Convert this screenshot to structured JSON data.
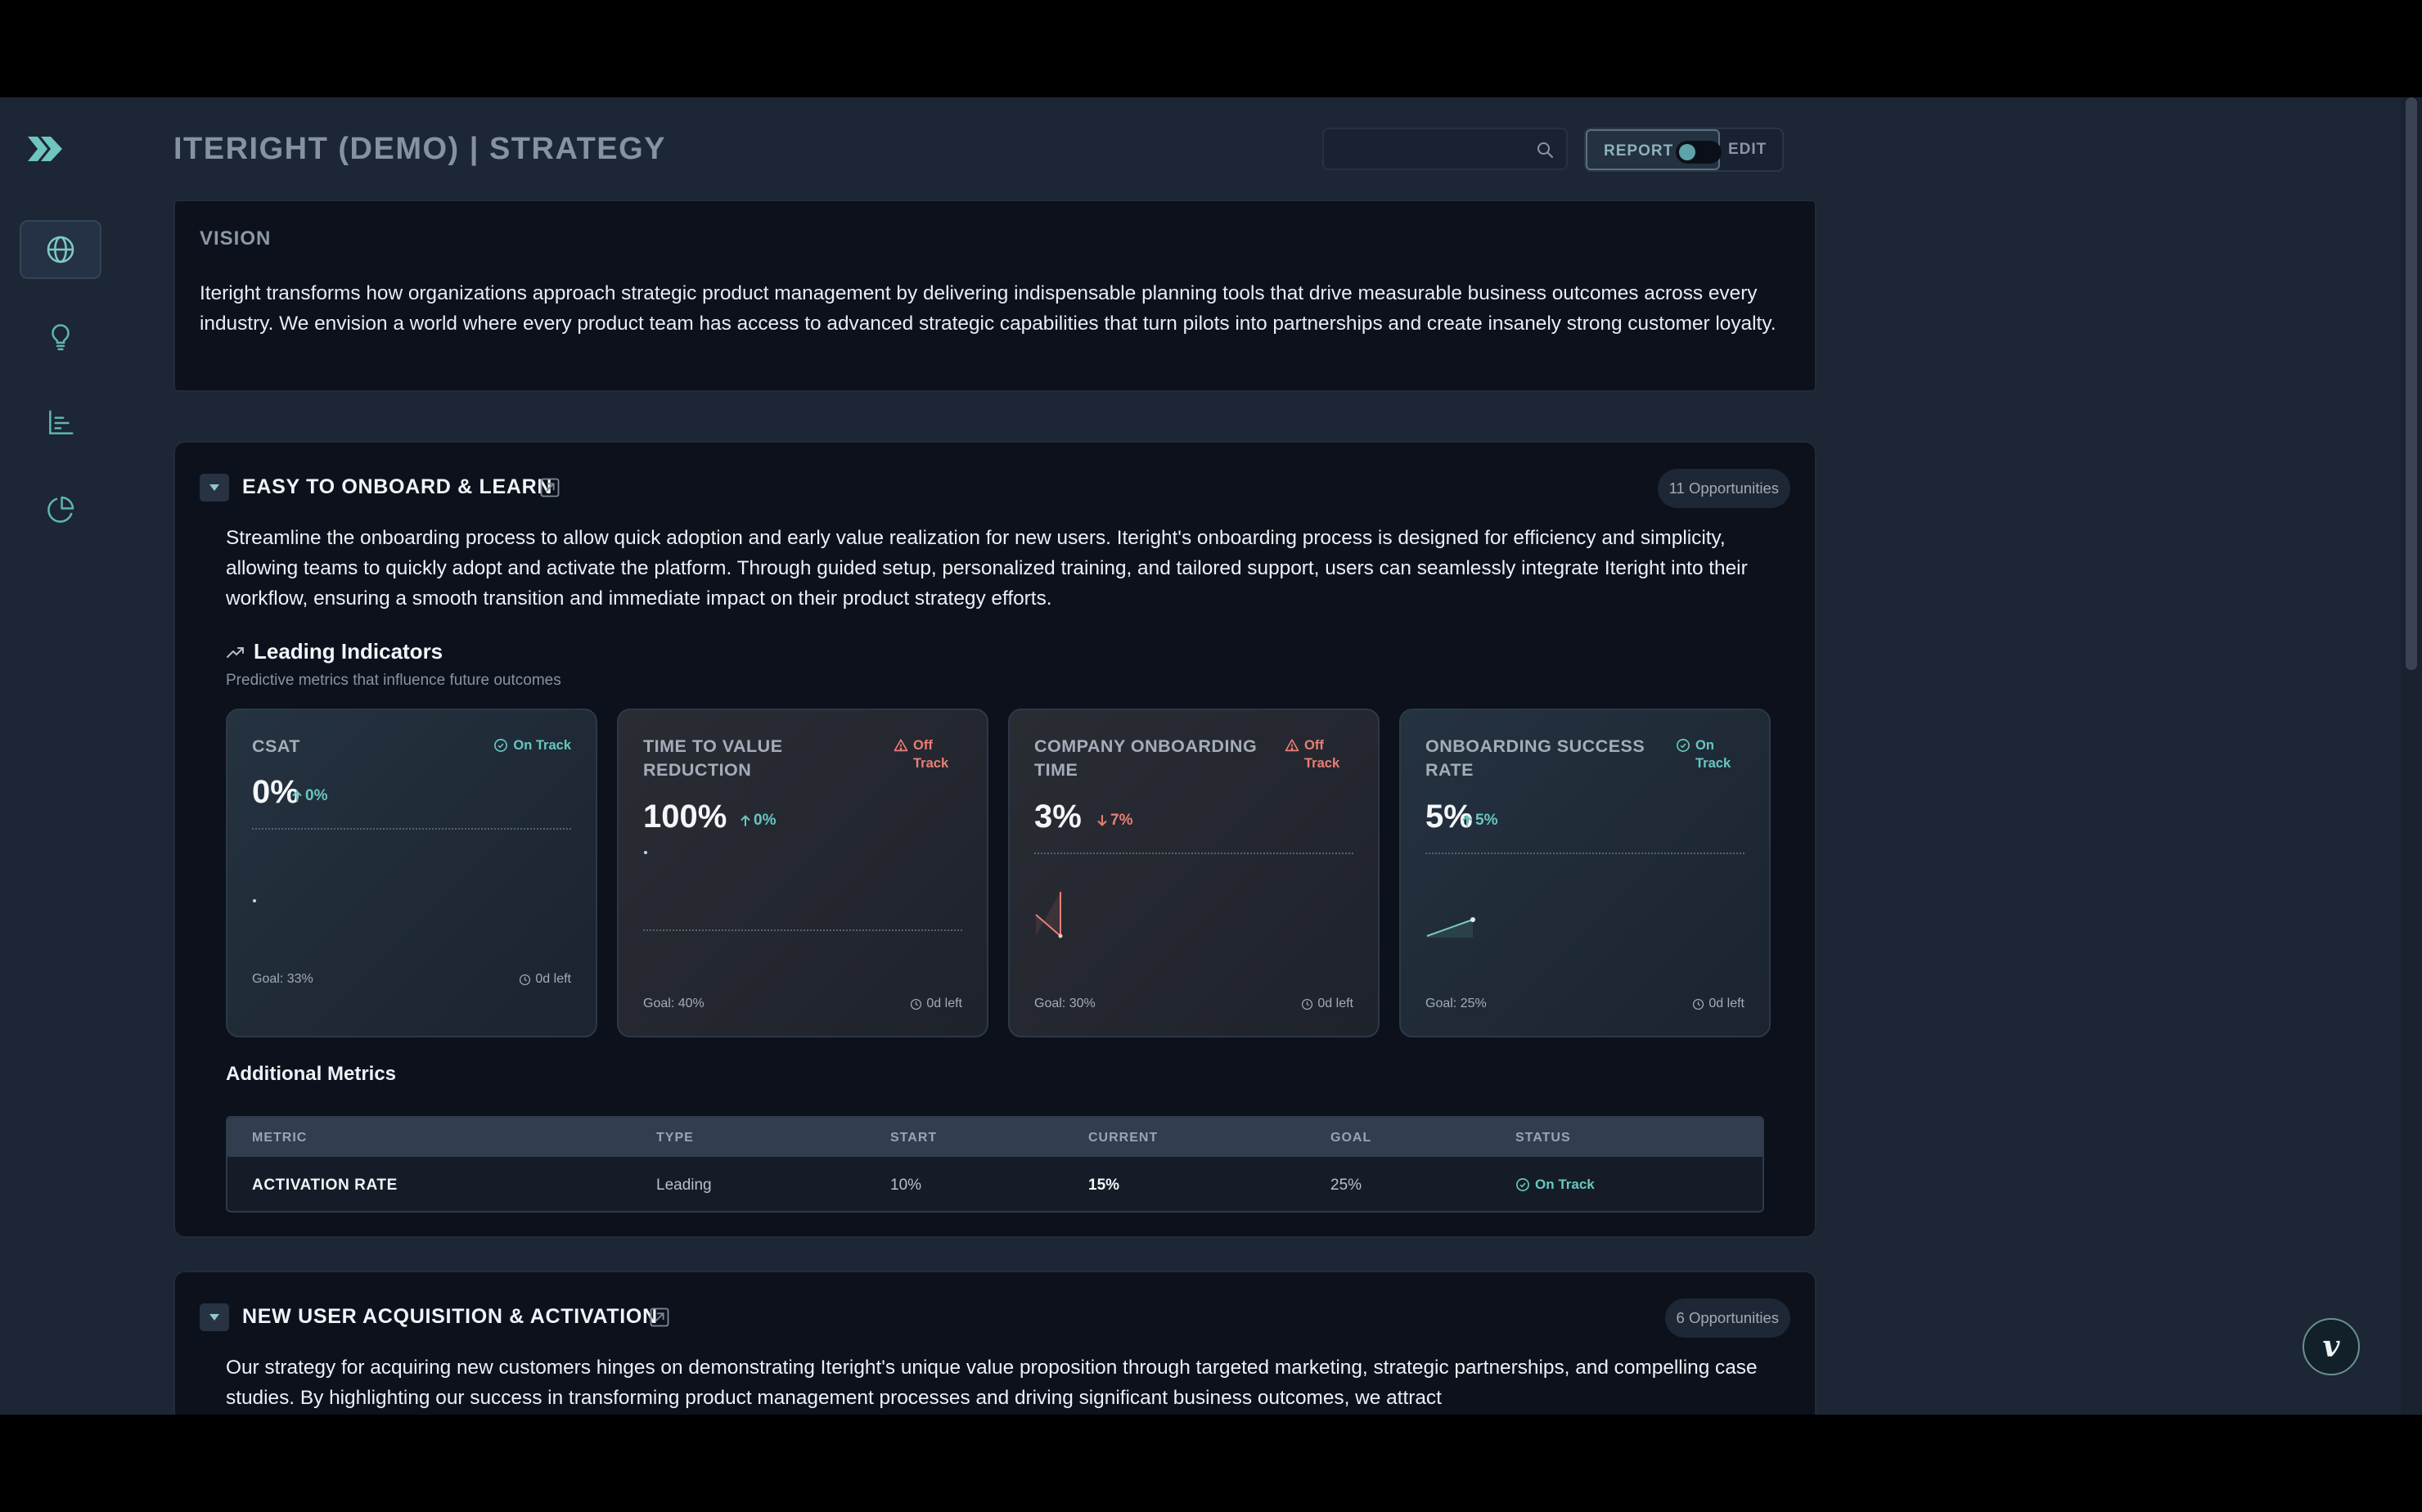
{
  "header": {
    "title": "ITERIGHT (DEMO) | STRATEGY",
    "search": {
      "placeholder": ""
    },
    "mode": {
      "report_label": "REPORT",
      "edit_label": "EDIT"
    }
  },
  "sidebar": {
    "logo_icon": "double-chevron-logo",
    "items": [
      {
        "icon": "globe-icon",
        "active": true
      },
      {
        "icon": "lightbulb-icon",
        "active": false
      },
      {
        "icon": "bar-list-icon",
        "active": false
      },
      {
        "icon": "pie-chart-icon",
        "active": false
      }
    ]
  },
  "vision": {
    "title": "VISION",
    "text": "Iteright transforms how organizations approach strategic product management by delivering indispensable planning tools that drive measurable business outcomes across every industry. We envision a world where every product team has access to advanced strategic capabilities that turn pilots into partnerships and create insanely strong customer loyalty."
  },
  "sections": [
    {
      "title": "EASY TO ONBOARD & LEARN",
      "opportunities": "11 Opportunities",
      "description": "Streamline the onboarding process to allow quick adoption and early value realization for new users. Iteright's onboarding process is designed for efficiency and simplicity, allowing teams to quickly adopt and activate the platform. Through guided setup, personalized training, and tailored support, users can seamlessly integrate Iteright into their workflow, ensuring a smooth transition and immediate impact on their product strategy efforts.",
      "leading_indicators": {
        "title": "Leading Indicators",
        "subtitle": "Predictive metrics that influence future outcomes",
        "cards": [
          {
            "title": "CSAT",
            "status": "On Track",
            "value": "0%",
            "delta": "0%",
            "delta_dir": "up",
            "goal": "Goal: 33%",
            "time_left": "0d left",
            "trend": [
              0
            ]
          },
          {
            "title": "TIME TO VALUE REDUCTION",
            "status": "Off Track",
            "value": "100%",
            "delta": "0%",
            "delta_dir": "up",
            "goal": "Goal: 40%",
            "time_left": "0d left",
            "trend": [
              100
            ]
          },
          {
            "title": "COMPANY ONBOARDING TIME",
            "status": "Off Track",
            "value": "3%",
            "delta": "7%",
            "delta_dir": "down",
            "goal": "Goal: 30%",
            "time_left": "0d left",
            "trend": [
              10,
              0,
              10
            ]
          },
          {
            "title": "ONBOARDING SUCCESS RATE",
            "status": "On Track",
            "value": "5%",
            "delta": "5%",
            "delta_dir": "up",
            "goal": "Goal: 25%",
            "time_left": "0d left",
            "trend": [
              0,
              5
            ]
          }
        ]
      },
      "additional_metrics": {
        "title": "Additional Metrics",
        "columns": [
          "METRIC",
          "TYPE",
          "START",
          "CURRENT",
          "GOAL",
          "STATUS"
        ],
        "rows": [
          {
            "metric": "ACTIVATION RATE",
            "type": "Leading",
            "start": "10%",
            "current": "15%",
            "goal": "25%",
            "status": "On Track"
          }
        ]
      }
    },
    {
      "title": "NEW USER ACQUISITION & ACTIVATION",
      "opportunities": "6 Opportunities",
      "description": "Our strategy for acquiring new customers hinges on demonstrating Iteright's unique value proposition through targeted marketing, strategic partnerships, and compelling case studies. By highlighting our success in transforming product management processes and driving significant business outcomes, we attract"
    }
  ],
  "fab": {
    "label": "v",
    "icon": "brand-v-icon"
  },
  "colors": {
    "background": "#1d2635",
    "panel": "#0c111b",
    "accent_teal": "#67c7bf",
    "off_track": "#e97f76"
  }
}
